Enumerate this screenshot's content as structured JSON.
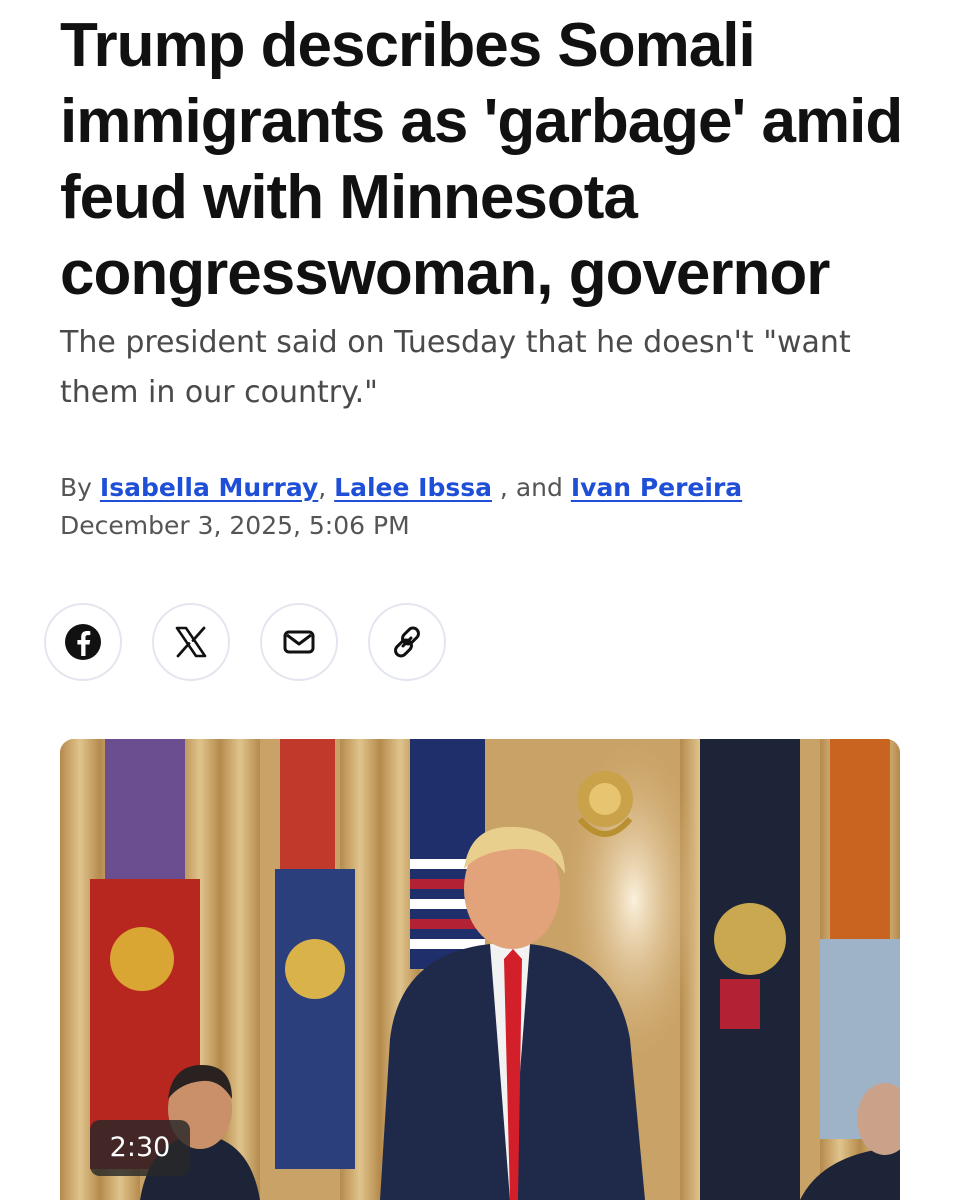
{
  "article": {
    "headline_lines": [
      "Trump describes Somali",
      "immigrants as 'garbage' amid",
      "feud with Minnesota",
      "congresswoman, governor"
    ],
    "subhead": "The president said on Tuesday that he doesn't \"want them in our country.\"",
    "byline": {
      "prefix": "By",
      "authors": [
        "Isabella Murray",
        "Lalee Ibssa",
        "Ivan Pereira"
      ],
      "sep1": ",",
      "sep2": " ,",
      "and": "and"
    },
    "date": "December 3, 2025, 5:06 PM"
  },
  "share": [
    {
      "icon": "facebook-icon",
      "label": "Share on Facebook"
    },
    {
      "icon": "x-icon",
      "label": "Share on X"
    },
    {
      "icon": "email-icon",
      "label": "Share via email"
    },
    {
      "icon": "link-icon",
      "label": "Copy link"
    }
  ],
  "video": {
    "duration": "2:30"
  }
}
